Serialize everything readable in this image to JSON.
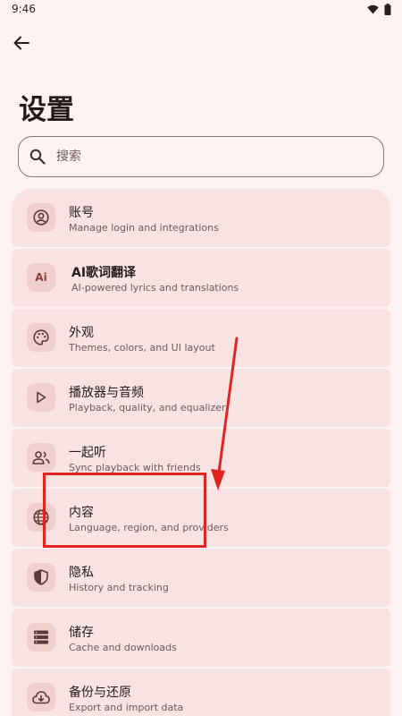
{
  "status_bar": {
    "time": "9:46",
    "icons": [
      "wifi-icon",
      "battery-icon"
    ]
  },
  "header": {
    "back_icon": "arrow-left-icon",
    "title": "设置"
  },
  "search": {
    "icon": "search-icon",
    "placeholder": "搜索"
  },
  "settings": {
    "items": [
      {
        "icon": "account-icon",
        "title": "账号",
        "subtitle": "Manage login and integrations"
      },
      {
        "icon": "ai-icon",
        "icon_text": "Ai",
        "title": "AI歌词翻译",
        "subtitle": "AI-powered lyrics and translations"
      },
      {
        "icon": "palette-icon",
        "title": "外观",
        "subtitle": "Themes, colors, and UI layout"
      },
      {
        "icon": "play-icon",
        "title": "播放器与音频",
        "subtitle": "Playback, quality, and equalizer"
      },
      {
        "icon": "people-icon",
        "title": "一起听",
        "subtitle": "Sync playback with friends"
      },
      {
        "icon": "globe-icon",
        "title": "内容",
        "subtitle": "Language, region, and providers"
      },
      {
        "icon": "shield-icon",
        "title": "隐私",
        "subtitle": "History and tracking"
      },
      {
        "icon": "storage-icon",
        "title": "储存",
        "subtitle": "Cache and downloads"
      },
      {
        "icon": "cloud-restore-icon",
        "title": "备份与还原",
        "subtitle": "Export and import data"
      }
    ]
  },
  "annotation": {
    "color": "#e02420"
  },
  "colors": {
    "background": "#fdf3f2",
    "card": "#f8e3e2",
    "icon_bg": "#f0cfcf",
    "accent": "#8c3f46"
  }
}
